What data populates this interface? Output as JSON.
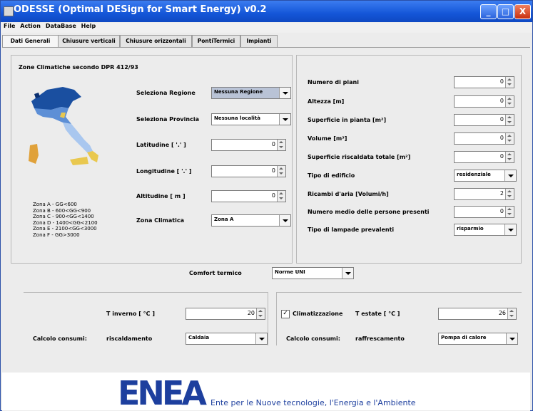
{
  "window": {
    "title": "ODESSE (Optimal DESign for Smart Energy) v0.2",
    "controls": {
      "minimize": "_",
      "maximize": "□",
      "close": "X"
    }
  },
  "menu": [
    "File",
    "Action",
    "DataBase",
    "Help"
  ],
  "tabs": [
    "Dati Generali",
    "Chiusure verticali",
    "Chiusure orizzontali",
    "PontiTermici",
    "Impianti"
  ],
  "left_panel": {
    "heading": "Zone Climatiche secondo DPR 412/93",
    "regione_label": "Seleziona Regione",
    "regione_value": "Nessuna Regione",
    "provincia_label": "Seleziona Provincia",
    "provincia_value": "Nessuna località",
    "latitudine_label": "Latitudine [ '.' ]",
    "latitudine_value": "0",
    "longitudine_label": "Longitudine [ '.' ]",
    "longitudine_value": "0",
    "altitudine_label": "Altitudine [ m ]",
    "altitudine_value": "0",
    "zona_label": "Zona Climatica",
    "zona_value": "Zona A",
    "legend": [
      "Zona A - GG<600",
      "Zona B - 600<GG<900",
      "Zona C - 900<GG<1400",
      "Zona D - 1400<GG<2100",
      "Zona E - 2100<GG<3000",
      "Zona F - GG>3000"
    ]
  },
  "right_panel": {
    "fields": [
      {
        "label": "Numero di piani",
        "value": "0",
        "kind": "spin"
      },
      {
        "label": "Altezza [m]",
        "value": "0",
        "kind": "spin"
      },
      {
        "label": "Superficie in pianta [m²]",
        "value": "0",
        "kind": "spin"
      },
      {
        "label": "Volume [m³]",
        "value": "0",
        "kind": "spin"
      },
      {
        "label": "Superficie riscaldata totale [m²]",
        "value": "0",
        "kind": "spin"
      },
      {
        "label": "Tipo di edificio",
        "value": "residenziale",
        "kind": "combo"
      },
      {
        "label": "Ricambi d'aria [Volumi/h]",
        "value": "2",
        "kind": "spin"
      },
      {
        "label": "Numero medio delle persone presenti",
        "value": "0",
        "kind": "spin"
      },
      {
        "label": "Tipo di lampade prevalenti",
        "value": "risparmio",
        "kind": "combo"
      }
    ]
  },
  "comfort": {
    "label": "Comfort termico",
    "value": "Norme UNI"
  },
  "winter": {
    "t_label": "T inverno [ °C ]",
    "t_value": "20",
    "consumi_label": "Calcolo consumi:",
    "mode_label": "riscaldamento",
    "system_value": "Caldaia"
  },
  "summer": {
    "checkbox_label": "Climatizzazione",
    "checked": true,
    "t_label": "T estate [ °C ]",
    "t_value": "26",
    "consumi_label": "Calcolo consumi:",
    "mode_label": "raffrescamento",
    "system_value": "Pompa di calore"
  },
  "footer": {
    "logo_text": "ENEA",
    "tagline": "Ente per le Nuove tecnologie, l'Energia e l'Ambiente"
  },
  "colors": {
    "titlebar": "#1456d8",
    "enea_blue": "#1d3f9e",
    "map_dark": "#1a4fa0",
    "map_mid": "#5d8fd6",
    "map_light": "#a9c7ef",
    "map_yellow": "#e9c84f",
    "map_orange": "#e0a13a"
  }
}
